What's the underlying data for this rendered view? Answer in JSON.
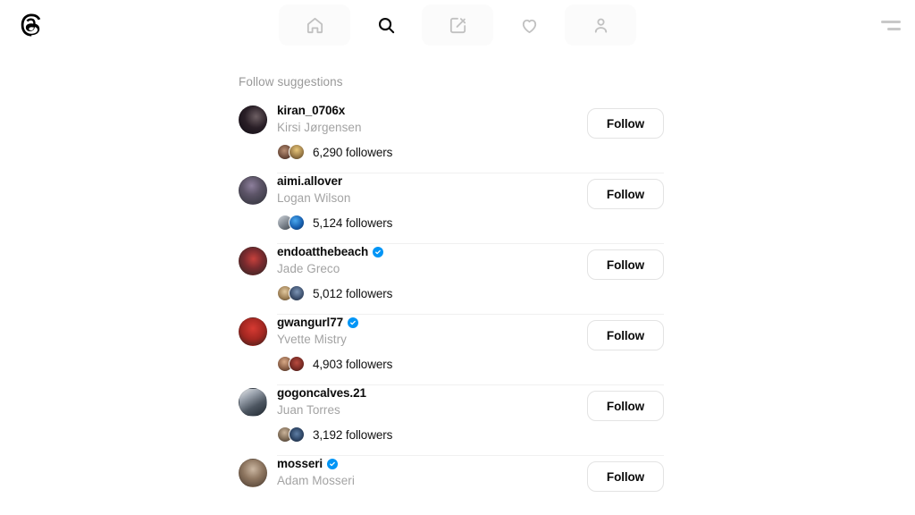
{
  "app": {
    "name": "Threads",
    "logo_icon": "threads-logo-icon"
  },
  "nav": {
    "items": [
      {
        "icon": "home-icon",
        "label": "Home",
        "active": false
      },
      {
        "icon": "search-icon",
        "label": "Search",
        "active": true
      },
      {
        "icon": "compose-icon",
        "label": "Create",
        "active": false
      },
      {
        "icon": "heart-icon",
        "label": "Activity",
        "active": false
      },
      {
        "icon": "profile-icon",
        "label": "Profile",
        "active": false
      }
    ],
    "menu_icon": "more-menu-icon"
  },
  "main": {
    "section_title": "Follow suggestions",
    "follow_label": "Follow",
    "verified_icon": "verified-badge-icon",
    "suggestions": [
      {
        "username": "kiran_0706x",
        "fullname": "Kirsi Jørgensen",
        "verified": false,
        "followers": "6,290 followers",
        "avatar_class": "av-kiran",
        "mini": [
          "mv-a",
          "mv-b"
        ]
      },
      {
        "username": "aimi.allover",
        "fullname": "Logan Wilson",
        "verified": false,
        "followers": "5,124 followers",
        "avatar_class": "av-aimi",
        "mini": [
          "mv-c",
          "mv-d"
        ]
      },
      {
        "username": "endoatthebeach",
        "fullname": "Jade Greco",
        "verified": true,
        "followers": "5,012 followers",
        "avatar_class": "av-endo",
        "mini": [
          "mv-e",
          "mv-f"
        ]
      },
      {
        "username": "gwangurl77",
        "fullname": "Yvette Mistry",
        "verified": true,
        "followers": "4,903 followers",
        "avatar_class": "av-gwan",
        "mini": [
          "mv-g",
          "mv-h"
        ]
      },
      {
        "username": "gogoncalves.21",
        "fullname": "Juan Torres",
        "verified": false,
        "followers": "3,192 followers",
        "avatar_class": "av-gogon",
        "mini": [
          "mv-i",
          "mv-j"
        ]
      },
      {
        "username": "mosseri",
        "fullname": "Adam Mosseri",
        "verified": true,
        "followers": "",
        "avatar_class": "av-mosseri",
        "mini": []
      }
    ]
  },
  "colors": {
    "accent_verified": "#0095f6",
    "text_primary": "#0b0b0b",
    "text_secondary": "#a3a3a3",
    "divider": "#f0f0f0",
    "background": "#ffffff"
  }
}
